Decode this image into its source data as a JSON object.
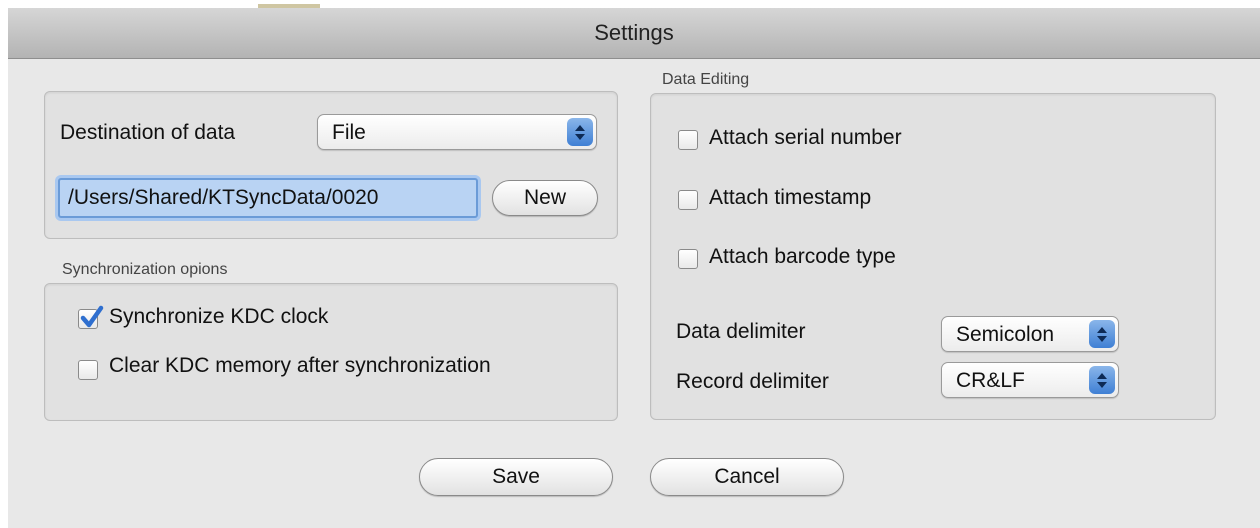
{
  "window": {
    "title": "Settings"
  },
  "destination": {
    "label": "Destination of data",
    "selected": "File",
    "path_value": "/Users/Shared/KTSyncData/0020",
    "new_button": "New"
  },
  "sync": {
    "group_label": "Synchronization opions",
    "items": [
      {
        "label": "Synchronize KDC clock",
        "checked": true
      },
      {
        "label": "Clear KDC memory after synchronization",
        "checked": false
      }
    ]
  },
  "editing": {
    "group_label": "Data Editing",
    "items": [
      {
        "label": "Attach serial number",
        "checked": false
      },
      {
        "label": "Attach timestamp",
        "checked": false
      },
      {
        "label": "Attach barcode type",
        "checked": false
      }
    ],
    "data_delimiter": {
      "label": "Data delimiter",
      "selected": "Semicolon"
    },
    "record_delimiter": {
      "label": "Record delimiter",
      "selected": "CR&LF"
    }
  },
  "buttons": {
    "save": "Save",
    "cancel": "Cancel"
  },
  "colors": {
    "accent": "#3f7fd4",
    "selection": "#b9d3f3",
    "check": "#2f6fcf"
  }
}
